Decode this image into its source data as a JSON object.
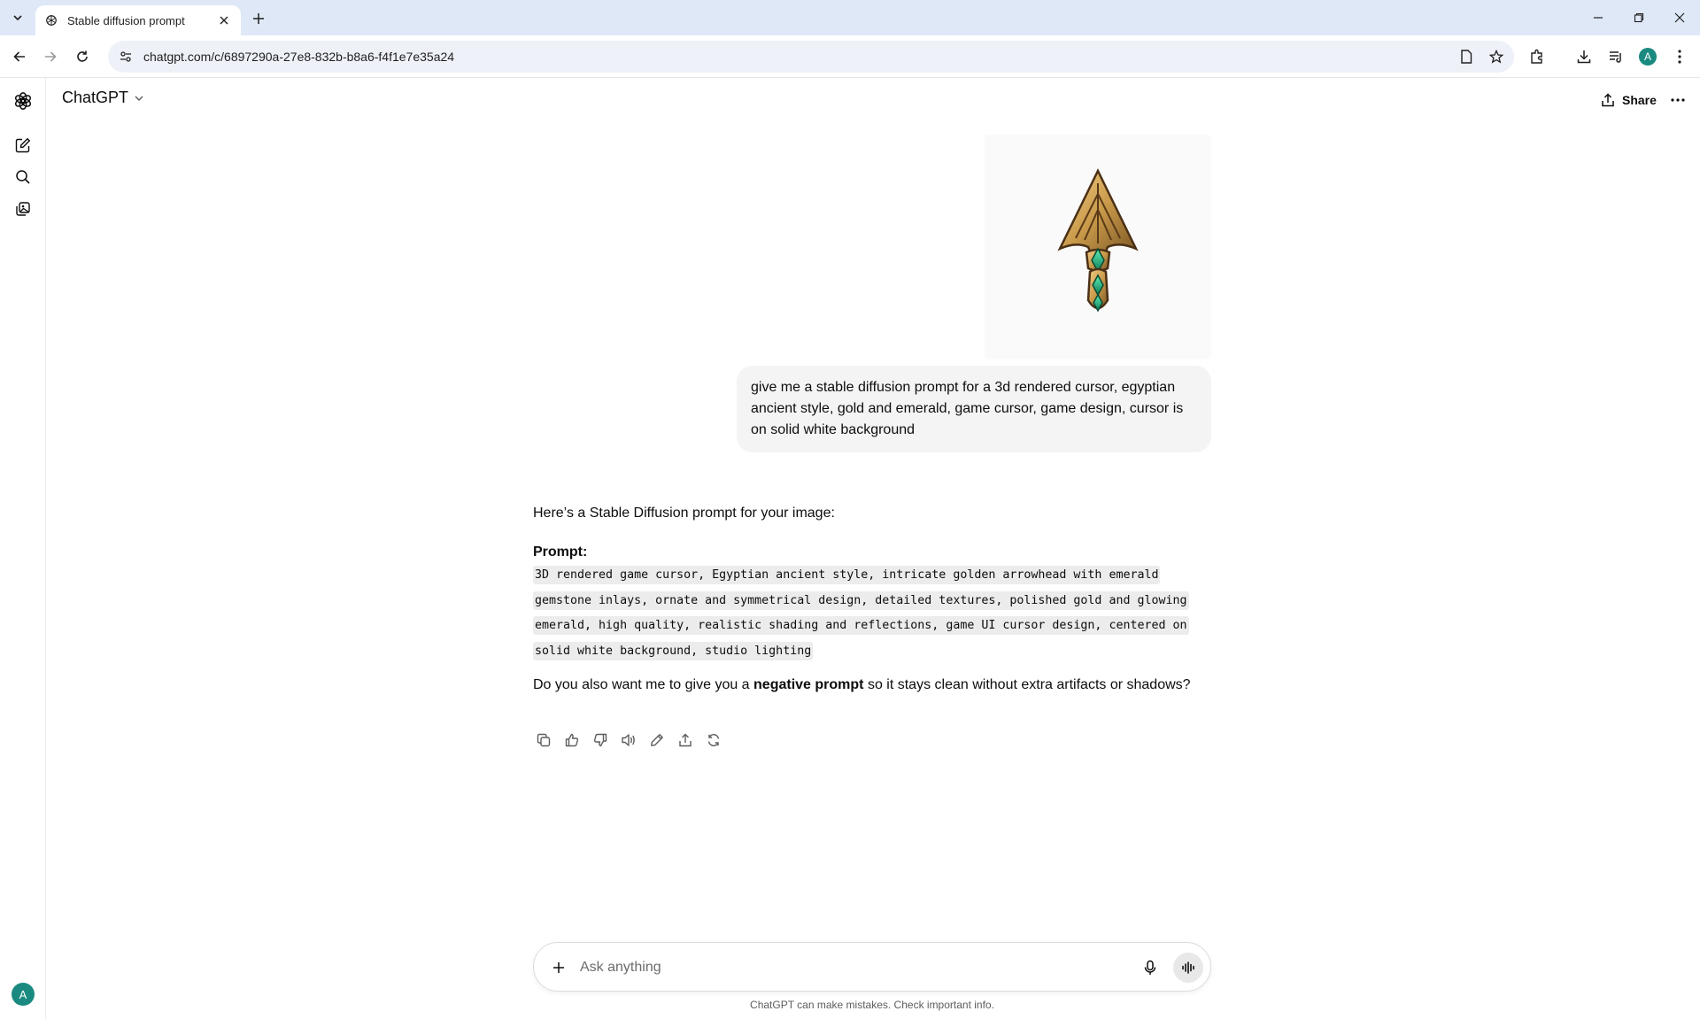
{
  "browser": {
    "tab_title": "Stable diffusion prompt",
    "url": "chatgpt.com/c/6897290a-27e8-832b-b8a6-f4f1e7e35a24",
    "profile_initial": "A"
  },
  "header": {
    "model_name": "ChatGPT",
    "share_label": "Share"
  },
  "conversation": {
    "user_message": "give me a stable diffusion prompt for a 3d rendered cursor, egyptian ancient style, gold and emerald, game cursor, game design, cursor is on solid white background",
    "assistant": {
      "intro": "Here’s a Stable Diffusion prompt for your image:",
      "prompt_label": "Prompt:",
      "prompt_code": "3D rendered game cursor, Egyptian ancient style, intricate golden arrowhead with emerald gemstone inlays, ornate and symmetrical design, detailed textures, polished gold and glowing emerald, high quality, realistic shading and reflections, game UI cursor design, centered on solid white background, studio lighting",
      "follow_before": "Do you also want me to give you a ",
      "follow_bold": "negative prompt",
      "follow_after": " so it stays clean without extra artifacts or shadows?"
    }
  },
  "composer": {
    "placeholder": "Ask anything"
  },
  "footer": {
    "disclaimer": "ChatGPT can make mistakes. Check important info."
  },
  "sidebar": {
    "avatar_initial": "A"
  },
  "icons": [
    "chevron-down-icon",
    "chatgpt-logo-icon",
    "close-icon",
    "plus-icon",
    "minimize-icon",
    "maximize-icon",
    "back-icon",
    "forward-icon",
    "reload-icon",
    "site-info-icon",
    "page-icon",
    "star-icon",
    "extensions-icon",
    "download-icon",
    "media-icon",
    "menu-dots-icon",
    "new-chat-icon",
    "search-icon",
    "library-icon",
    "share-icon",
    "copy-icon",
    "thumbs-up-icon",
    "thumbs-down-icon",
    "read-aloud-icon",
    "edit-icon",
    "regenerate-icon",
    "mic-icon",
    "voice-mode-icon"
  ],
  "colors": {
    "tabbar_bg": "#dfe8f7",
    "omnibox_bg": "#eef1f8",
    "user_bubble_bg": "#f4f4f4",
    "code_bg": "#ececec",
    "avatar_bg": "#1a8a80",
    "gold": "#c99a4a",
    "emerald": "#1ea97a"
  }
}
